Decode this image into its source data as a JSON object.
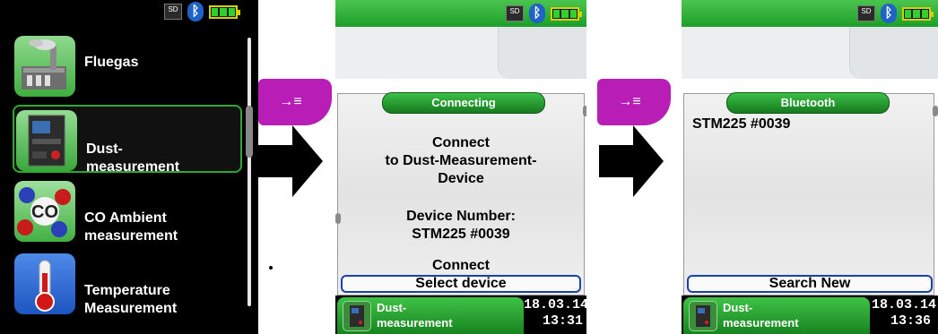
{
  "menu": {
    "status": {
      "sd": "SD"
    },
    "items": [
      {
        "label": "Fluegas",
        "icon": "factory-smokestack-icon"
      },
      {
        "label": "Dust-\nmeasurement",
        "icon": "dust-meter-device-icon",
        "selected": true
      },
      {
        "label": "CO Ambient\nmeasurement",
        "icon": "co-molecule-icon"
      },
      {
        "label": "Temperature\nMeasurement",
        "icon": "thermometer-icon"
      }
    ]
  },
  "connecting_screen": {
    "status": {
      "sd": "SD"
    },
    "tag_icon": "arrow-to-list-icon",
    "header": "Connecting",
    "lines": {
      "connect_to": "Connect\nto Dust-Measurement-\nDevice",
      "device_number_label": "Device Number:",
      "device_number": "STM225 #0039",
      "connect": "Connect"
    },
    "select_button": "Select device",
    "bottom": {
      "label": "Dust-\nmeasurement",
      "date": "18.03.14",
      "time": "13:31"
    }
  },
  "bluetooth_screen": {
    "status": {
      "sd": "SD"
    },
    "tag_icon": "arrow-to-list-icon",
    "header": "Bluetooth",
    "device_list": [
      "STM225 #0039"
    ],
    "search_button": "Search New",
    "bottom": {
      "label": "Dust-\nmeasurement",
      "date": "18.03.14",
      "time": "13:36"
    }
  },
  "colors": {
    "accent_green": "#2fa82f",
    "tag_magenta": "#b81db5",
    "button_border": "#1c3fae"
  }
}
